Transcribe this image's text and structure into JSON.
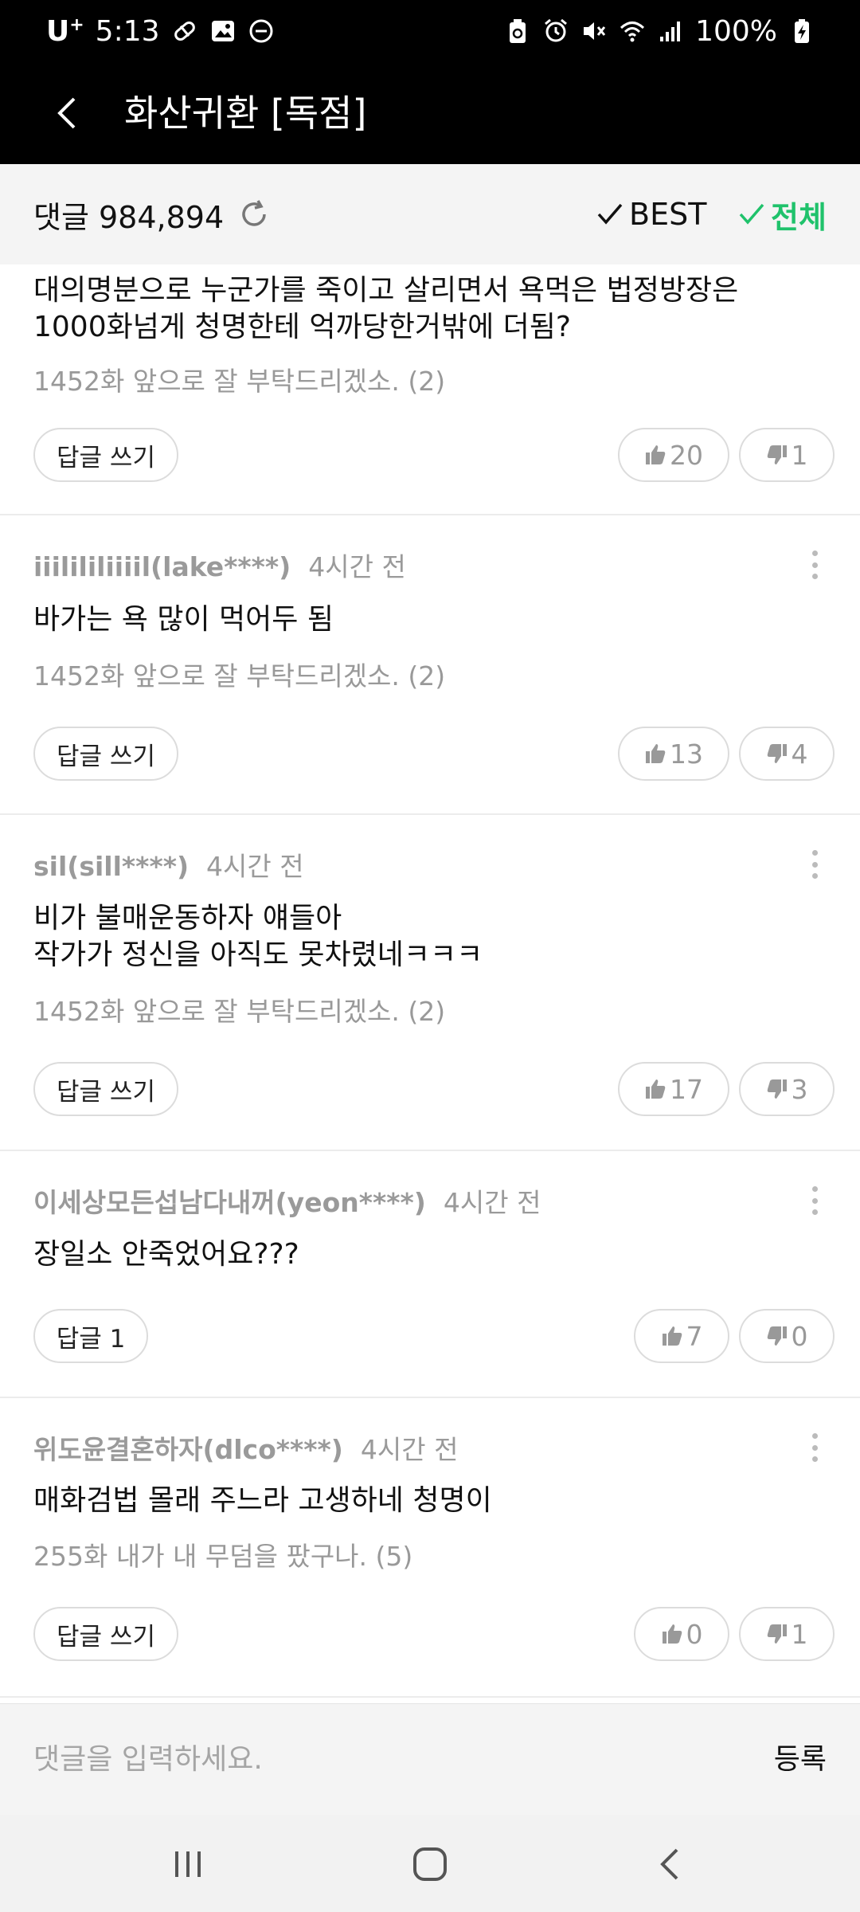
{
  "status_bar": {
    "carrier": "U",
    "carrier_sup": "+",
    "time": "5:13",
    "battery": "100%"
  },
  "header": {
    "title": "화산귀환 [독점]"
  },
  "comments_header": {
    "label": "댓글 984,894",
    "filter_best": "BEST",
    "filter_all": "전체",
    "accent_color": "#1fc26b"
  },
  "comments": [
    {
      "text_line1": "대의명분으로 누군가를 죽이고 살리면서 욕먹은 법정방장은",
      "text_line2": "1000화넘게  청명한테 억까당한거밖에 더됨?",
      "episode": "1452화 앞으로 잘 부탁드리겠소. (2)",
      "reply": "답글 쓰기",
      "likes": "20",
      "dislikes": "1"
    },
    {
      "nick": "iiilililiiiil(lake****)",
      "time": "4시간 전",
      "text": "바가는 욕 많이 먹어두 됨",
      "episode": "1452화 앞으로 잘 부탁드리겠소. (2)",
      "reply": "답글 쓰기",
      "likes": "13",
      "dislikes": "4"
    },
    {
      "nick": "sil(sill****)",
      "time": "4시간 전",
      "text": "비가 불매운동하자 얘들아\n작가가 정신을 아직도 못차렸네ㅋㅋㅋ",
      "episode": "1452화 앞으로 잘 부탁드리겠소. (2)",
      "reply": "답글 쓰기",
      "likes": "17",
      "dislikes": "3"
    },
    {
      "nick": "이세상모든섭남다내꺼(yeon****)",
      "time": "4시간 전",
      "text": "장일소 안죽었어요???",
      "reply": "답글 1",
      "likes": "7",
      "dislikes": "0"
    },
    {
      "nick": "위도윤결혼하자(dlco****)",
      "time": "4시간 전",
      "text": "매화검법 몰래 주느라 고생하네 청명이",
      "episode": "255화 내가 내 무덤을 팠구나. (5)",
      "reply": "답글 쓰기",
      "likes": "0",
      "dislikes": "1"
    }
  ],
  "input_bar": {
    "placeholder": "댓글을 입력하세요.",
    "submit": "등록"
  },
  "icons": {
    "back": "chevron-left-icon",
    "refresh": "refresh-icon",
    "like": "thumbs-up-icon",
    "dislike": "thumbs-down-icon",
    "more": "more-vertical-icon"
  }
}
